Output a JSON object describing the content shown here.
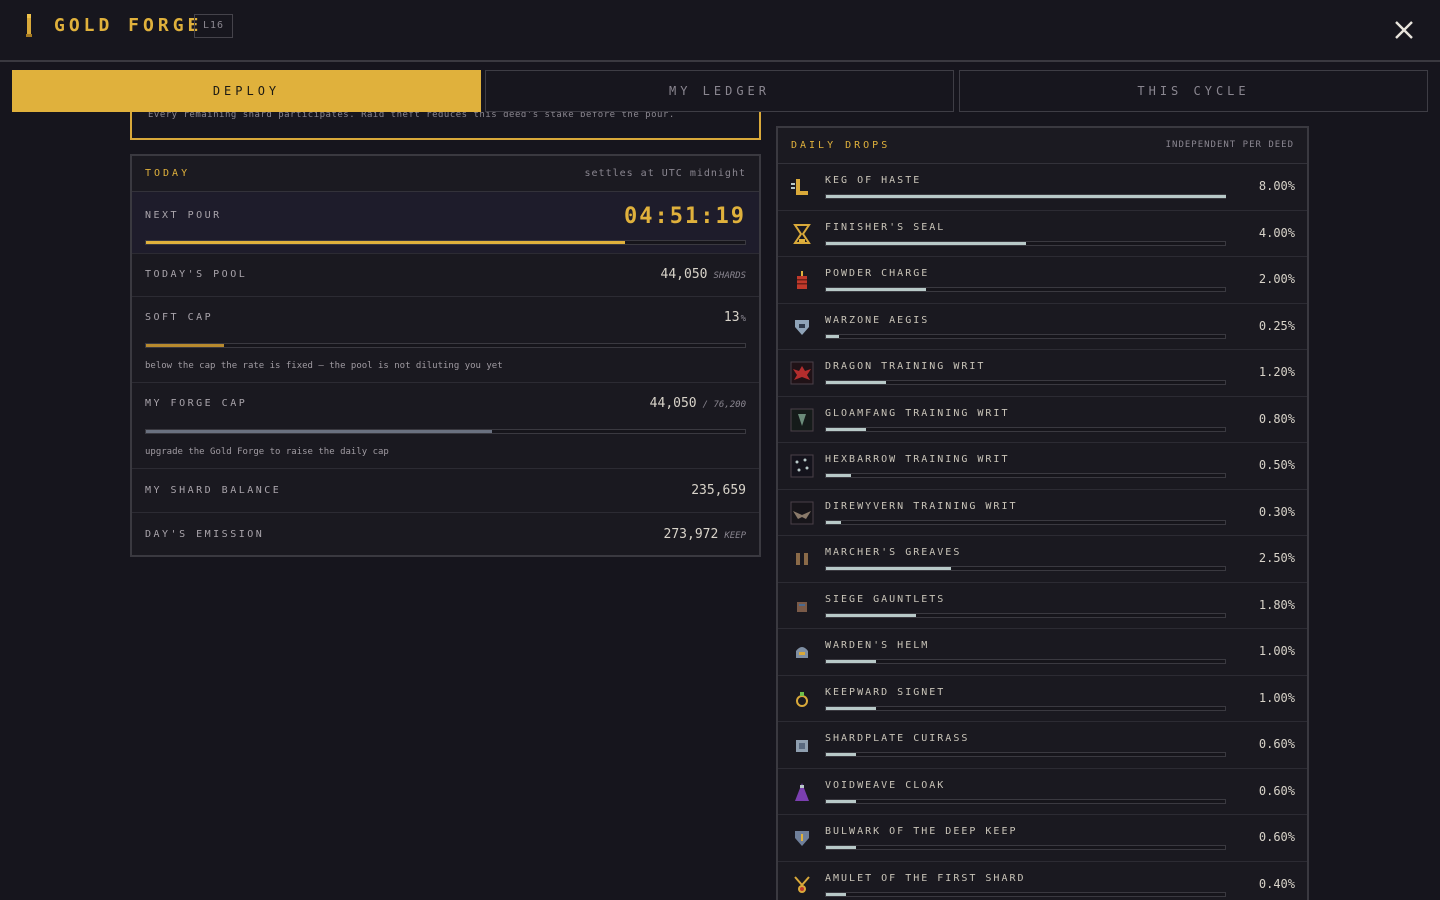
{
  "header": {
    "title": "GOLD FORGE",
    "level": "L16"
  },
  "tabs": [
    {
      "label": "DEPLOY",
      "active": true
    },
    {
      "label": "MY LEDGER",
      "active": false
    },
    {
      "label": "THIS CYCLE",
      "active": false
    }
  ],
  "notice": "Every remaining shard participates. Raid theft reduces this deed's stake before the pour.",
  "today": {
    "title": "TODAY",
    "subtitle": "settles at UTC midnight",
    "next_pour_label": "NEXT POUR",
    "next_pour_time": "04:51:19",
    "next_pour_progress": 0.8,
    "pool_label": "TODAY'S POOL",
    "pool_value": "44,050",
    "pool_unit": "SHARDS",
    "soft_cap_label": "SOFT CAP",
    "soft_cap_value": "13",
    "soft_cap_unit": "%",
    "soft_cap_progress": 0.13,
    "soft_cap_note": "below the cap the rate is fixed — the pool is not diluting you yet",
    "forge_cap_label": "MY FORGE CAP",
    "forge_cap_value": "44,050",
    "forge_cap_max": "/ 76,200",
    "forge_cap_progress": 0.578,
    "forge_cap_note": "upgrade the Gold Forge to raise the daily cap",
    "balance_label": "MY SHARD BALANCE",
    "balance_value": "235,659",
    "emission_label": "DAY'S EMISSION",
    "emission_value": "273,972",
    "emission_unit": "KEEP"
  },
  "drops": {
    "title": "DAILY DROPS",
    "subtitle": "INDEPENDENT PER DEED",
    "items": [
      {
        "name": "KEG OF HASTE",
        "pct": "8.00%",
        "value": 8.0,
        "icon": "keg-icon"
      },
      {
        "name": "FINISHER'S SEAL",
        "pct": "4.00%",
        "value": 4.0,
        "icon": "hourglass-icon"
      },
      {
        "name": "POWDER CHARGE",
        "pct": "2.00%",
        "value": 2.0,
        "icon": "dynamite-icon"
      },
      {
        "name": "WARZONE AEGIS",
        "pct": "0.25%",
        "value": 0.25,
        "icon": "shield-icon"
      },
      {
        "name": "DRAGON TRAINING WRIT",
        "pct": "1.20%",
        "value": 1.2,
        "icon": "dragon-icon"
      },
      {
        "name": "GLOAMFANG TRAINING WRIT",
        "pct": "0.80%",
        "value": 0.8,
        "icon": "gloamfang-icon"
      },
      {
        "name": "HEXBARROW TRAINING WRIT",
        "pct": "0.50%",
        "value": 0.5,
        "icon": "hexbarrow-icon"
      },
      {
        "name": "DIREWYVERN TRAINING WRIT",
        "pct": "0.30%",
        "value": 0.3,
        "icon": "wyvern-icon"
      },
      {
        "name": "MARCHER'S GREAVES",
        "pct": "2.50%",
        "value": 2.5,
        "icon": "greaves-icon"
      },
      {
        "name": "SIEGE GAUNTLETS",
        "pct": "1.80%",
        "value": 1.8,
        "icon": "gauntlets-icon"
      },
      {
        "name": "WARDEN'S HELM",
        "pct": "1.00%",
        "value": 1.0,
        "icon": "helm-icon"
      },
      {
        "name": "KEEPWARD SIGNET",
        "pct": "1.00%",
        "value": 1.0,
        "icon": "ring-icon"
      },
      {
        "name": "SHARDPLATE CUIRASS",
        "pct": "0.60%",
        "value": 0.6,
        "icon": "cuirass-icon"
      },
      {
        "name": "VOIDWEAVE CLOAK",
        "pct": "0.60%",
        "value": 0.6,
        "icon": "cloak-icon"
      },
      {
        "name": "BULWARK OF THE DEEP KEEP",
        "pct": "0.60%",
        "value": 0.6,
        "icon": "bulwark-icon"
      },
      {
        "name": "AMULET OF THE FIRST SHARD",
        "pct": "0.40%",
        "value": 0.4,
        "icon": "amulet-icon"
      }
    ]
  },
  "colors": {
    "accent": "#e0b13c",
    "bar_drop": "#b8c9c8",
    "bar_soft_cap": "#b88a2e",
    "bar_forge_cap": "#6a7180"
  }
}
